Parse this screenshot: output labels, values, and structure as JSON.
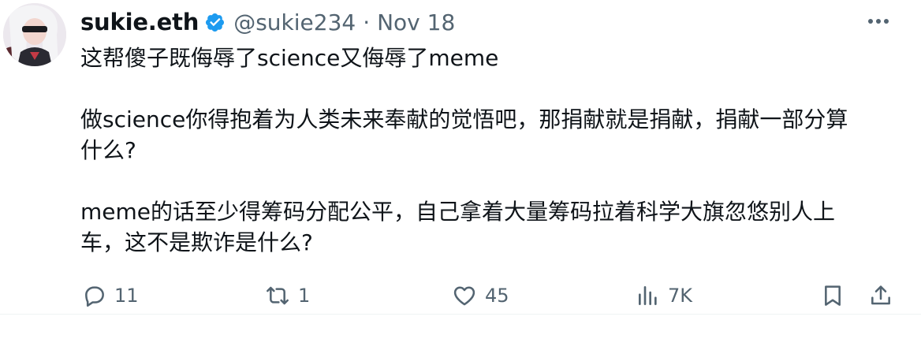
{
  "author": {
    "display_name": "sukie.eth",
    "handle": "@sukie234",
    "separator": "·",
    "date": "Nov 18",
    "verified": true
  },
  "tweet": {
    "line1": "这帮傻子既侮辱了science又侮辱了meme",
    "para2_line1": "做science你得抱着为人类未来奉献的觉悟吧，那捐献就是捐献，捐献一部分算",
    "para2_line2": "什么?",
    "para3_line1": "meme的话至少得筹码分配公平，自己拿着大量筹码拉着科学大旗忽悠别人上",
    "para3_line2": "车，这不是欺诈是什么?"
  },
  "actions": {
    "replies": "11",
    "reposts": "1",
    "likes": "45",
    "views": "7K"
  },
  "colors": {
    "text": "#0f1419",
    "muted": "#536471",
    "verified_blue": "#1d9bf0"
  },
  "icons": [
    "verified-badge-icon",
    "more-icon",
    "reply-icon",
    "repost-icon",
    "like-icon",
    "views-icon",
    "bookmark-icon",
    "share-icon"
  ]
}
